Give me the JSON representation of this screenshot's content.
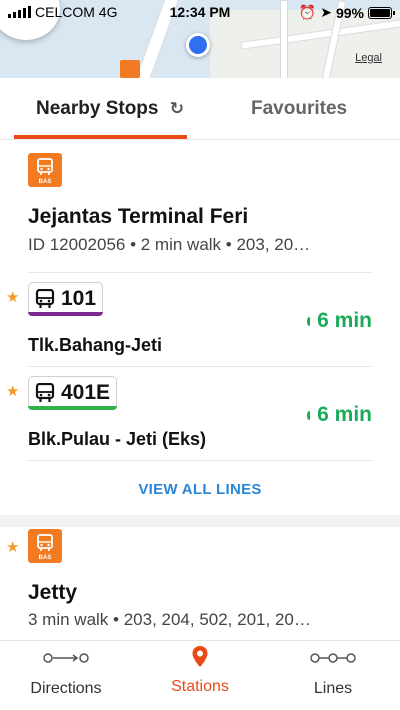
{
  "status_bar": {
    "carrier": "CELCOM 4G",
    "time": "12:34 PM",
    "battery": "99%"
  },
  "map": {
    "legal_label": "Legal"
  },
  "tabs": [
    {
      "label": "Nearby Stops",
      "active": true
    },
    {
      "label": "Favourites",
      "active": false
    }
  ],
  "stops": [
    {
      "icon": "bus-stop-icon",
      "icon_text": "BAS",
      "name": "Jejantas Terminal Feri",
      "info": "ID 12002056 • 2 min walk • 203, 20…",
      "routes": [
        {
          "number": "101",
          "destination": "Tlk.Bahang-Jeti",
          "eta": "6 min",
          "line_color": "#7b2c91",
          "favourite": true
        },
        {
          "number": "401E",
          "destination": "Blk.Pulau - Jeti (Eks)",
          "eta": "6 min",
          "line_color": "#2db34a",
          "favourite": true
        }
      ],
      "view_all_label": "VIEW ALL LINES"
    },
    {
      "icon": "bus-stop-icon",
      "icon_text": "BAS",
      "name": "Jetty",
      "info": "3 min walk • 203, 204, 502, 201, 20…",
      "favourite": true
    }
  ],
  "bottom_nav": [
    {
      "label": "Directions",
      "icon": "directions-icon",
      "active": false
    },
    {
      "label": "Stations",
      "icon": "location-pin-icon",
      "active": true
    },
    {
      "label": "Lines",
      "icon": "lines-icon",
      "active": false
    }
  ],
  "colors": {
    "accent": "#ea4b16",
    "bus_orange": "#f27b21",
    "eta_green": "#1bab58",
    "link_blue": "#2a86d6",
    "star": "#f39a2a"
  }
}
